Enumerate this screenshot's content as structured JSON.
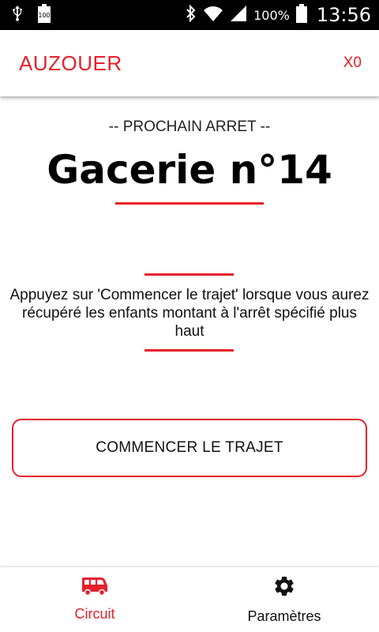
{
  "status_bar": {
    "battery_badge": "100",
    "battery_percent": "100%",
    "time": "13:56",
    "icons": [
      "usb-icon",
      "battery-badge-icon",
      "bluetooth-icon",
      "wifi-icon",
      "signal-icon",
      "battery-icon"
    ]
  },
  "app_bar": {
    "title": "AUZOUER",
    "counter": "X0"
  },
  "main": {
    "next_stop_label": "-- PROCHAIN ARRET --",
    "stop_name": "Gacerie n°14",
    "instructions": "Appuyez sur 'Commencer le trajet' lorsque vous aurez récupéré les enfants montant à l'arrêt spécifié plus haut",
    "start_button_label": "COMMENCER LE TRAJET"
  },
  "bottom_nav": {
    "items": [
      {
        "label": "Circuit",
        "icon": "bus-icon",
        "active": true
      },
      {
        "label": "Paramètres",
        "icon": "gear-icon",
        "active": false
      }
    ]
  },
  "colors": {
    "accent": "#e8202a",
    "status_bar": "#000000",
    "background": "#ffffff"
  }
}
